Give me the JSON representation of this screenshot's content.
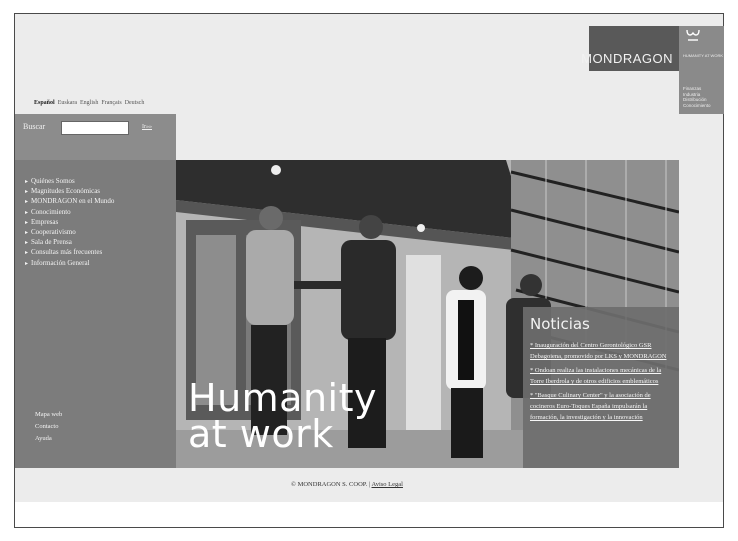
{
  "brand": {
    "name": "MONDRAGON",
    "tagline": "HUMANITY AT WORK",
    "sectors": [
      "Finanzas",
      "Industria",
      "Distribución",
      "Conocimiento"
    ]
  },
  "languages": [
    "Español",
    "Euskara",
    "English",
    "Français",
    "Deutsch"
  ],
  "search": {
    "label": "Buscar",
    "placeholder": "",
    "value": "",
    "submit": "Ir»»"
  },
  "menu": {
    "items": [
      "Quiénes Somos",
      "Magnitudes Económicas",
      "MONDRAGON en el Mundo",
      "Conocimiento",
      "Empresas",
      "Cooperativismo",
      "Sala de Prensa",
      "Consultas más frecuentes",
      "Información General"
    ],
    "utility": [
      "Mapa web",
      "Contacto",
      "Ayuda"
    ]
  },
  "hero": {
    "line1": "Humanity",
    "line2": "at work"
  },
  "news": {
    "title": "Noticias",
    "items": [
      "* Inauguración del Centro Gerontológico GSR Debagoiena, promovido por LKS y MONDRAGON",
      "* Ondoan realiza las instalaciones mecánicas de la Torre Iberdrola y de otros edificios emblemáticos",
      "* \"Basque Culinary Center\" y la asociación de cocineros Euro-Toques España impulsarán la formación, la investigación y la innovación"
    ]
  },
  "footer": {
    "copyright": "© MONDRAGON S. COOP. |",
    "legal_link": "Aviso Legal"
  },
  "colors": {
    "page_bg": "#ececec",
    "sidebar": "#7c7c7c",
    "search_panel": "#8c8c8c",
    "logo_dark": "#595959",
    "news_bg": "#6e6e6e"
  }
}
